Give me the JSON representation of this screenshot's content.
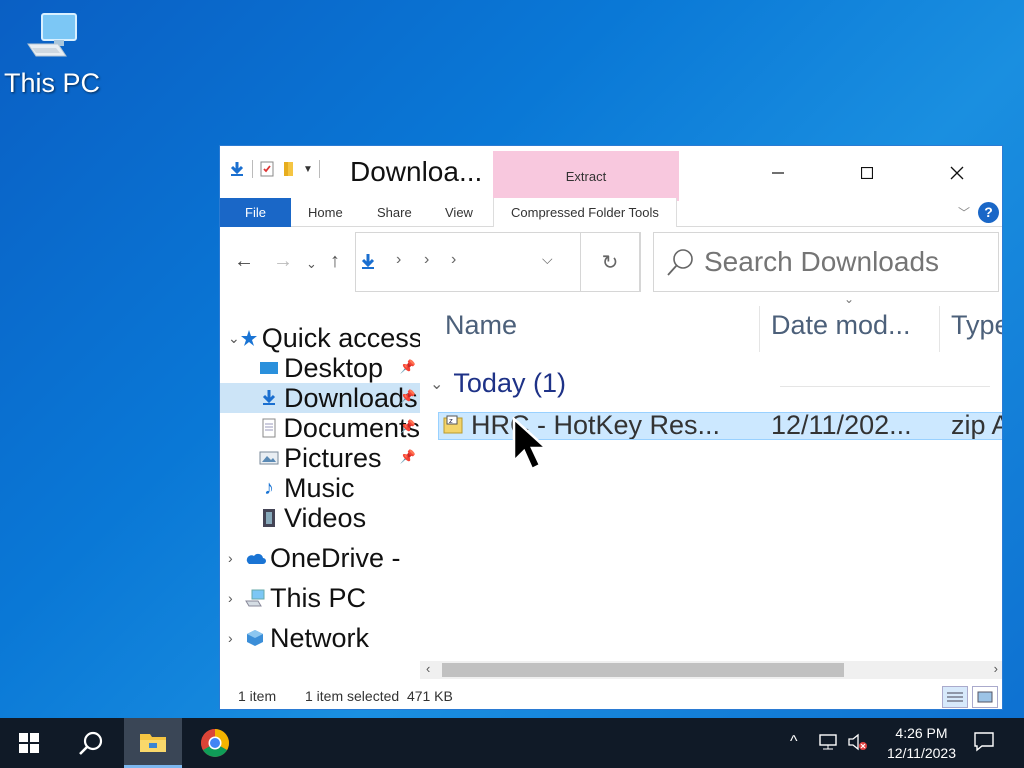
{
  "desktop": {
    "icons": [
      {
        "label": "This PC",
        "icon": "computer-icon"
      }
    ]
  },
  "window": {
    "title": "Downloa...",
    "contextual_tab_group": "Extract",
    "ribbon_tabs": [
      {
        "label": "File"
      },
      {
        "label": "Home"
      },
      {
        "label": "Share"
      },
      {
        "label": "View"
      },
      {
        "label": "Compressed Folder Tools"
      }
    ],
    "help_label": "?",
    "search_placeholder": "Search Downloads",
    "nav_pane": [
      {
        "label": "Quick access",
        "icon": "star-icon",
        "expanded": true
      },
      {
        "label": "Desktop",
        "icon": "desktop-folder-icon",
        "pinned": true
      },
      {
        "label": "Downloads",
        "icon": "downloads-icon",
        "pinned": true,
        "selected": true
      },
      {
        "label": "Documents",
        "icon": "documents-icon",
        "pinned": true
      },
      {
        "label": "Pictures",
        "icon": "pictures-icon",
        "pinned": true
      },
      {
        "label": "Music",
        "icon": "music-icon"
      },
      {
        "label": "Videos",
        "icon": "videos-icon"
      },
      {
        "label": "OneDrive -",
        "icon": "onedrive-icon"
      },
      {
        "label": "This PC",
        "icon": "computer-icon"
      },
      {
        "label": "Network",
        "icon": "network-icon"
      }
    ],
    "columns": [
      {
        "label": "Name"
      },
      {
        "label": "Date mod..."
      },
      {
        "label": "Type"
      }
    ],
    "group": {
      "label": "Today (1)"
    },
    "files": [
      {
        "name": "HRC - HotKey Res...",
        "date": "12/11/202...",
        "type": "zip A",
        "icon": "zip-folder-icon"
      }
    ],
    "status": {
      "count": "1 item",
      "selection": "1 item selected  471 KB"
    }
  },
  "taskbar": {
    "time": "4:26 PM",
    "date": "12/11/2023"
  }
}
